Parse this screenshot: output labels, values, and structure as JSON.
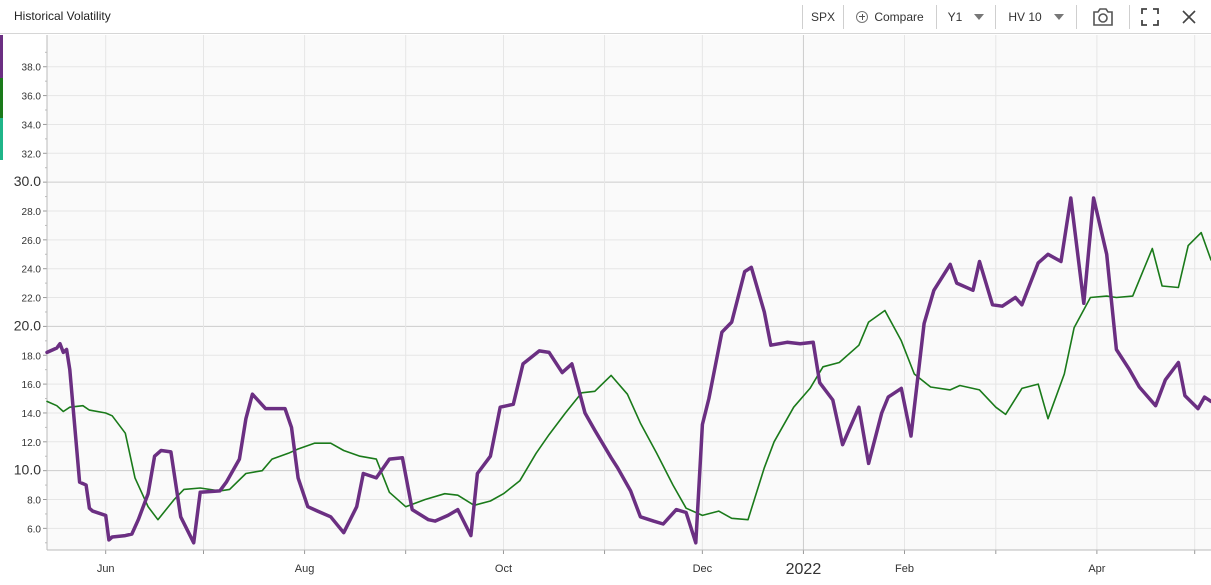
{
  "toolbar": {
    "title": "Historical Volatility",
    "symbol": "SPX",
    "compare_label": "Compare",
    "range_value": "Y1",
    "indicator_value": "HV 10",
    "icons": [
      "plus-circle-icon",
      "chevron-down-icon",
      "camera-icon",
      "fullscreen-icon",
      "close-icon"
    ]
  },
  "colors": {
    "series_primary": "#6b2f82",
    "series_secondary": "#1a7a1a",
    "grid": "#e6e6e6",
    "major_grid": "#cccccc",
    "strip": [
      "#6b2f82",
      "#1a7a1a",
      "#1fb589"
    ]
  },
  "chart_data": {
    "type": "line",
    "title": "",
    "xlabel": "",
    "ylabel": "",
    "x_range": [
      "2021-05-14",
      "2022-05-06"
    ],
    "ylim": [
      4.5,
      40.2
    ],
    "y_ticks": [
      {
        "v": 6,
        "label": "6.0"
      },
      {
        "v": 8,
        "label": "8.0"
      },
      {
        "v": 10,
        "label": "10.0"
      },
      {
        "v": 12,
        "label": "12.0"
      },
      {
        "v": 14,
        "label": "14.0"
      },
      {
        "v": 16,
        "label": "16.0"
      },
      {
        "v": 18,
        "label": "18.0"
      },
      {
        "v": 20,
        "label": "20.0"
      },
      {
        "v": 22,
        "label": "22.0"
      },
      {
        "v": 24,
        "label": "24.0"
      },
      {
        "v": 26,
        "label": "26.0"
      },
      {
        "v": 28,
        "label": "28.0"
      },
      {
        "v": 30,
        "label": "30.0"
      },
      {
        "v": 32,
        "label": "32.0"
      },
      {
        "v": 34,
        "label": "34.0"
      },
      {
        "v": 36,
        "label": "36.0"
      },
      {
        "v": 38,
        "label": "38.0"
      }
    ],
    "major_y": [
      10,
      20,
      30
    ],
    "x_ticks": [
      {
        "date": "2021-06-01",
        "label": "Jun"
      },
      {
        "date": "2021-08-01",
        "label": "Aug"
      },
      {
        "date": "2021-10-01",
        "label": "Oct"
      },
      {
        "date": "2021-12-01",
        "label": "Dec"
      },
      {
        "date": "2022-01-01",
        "label": "2022",
        "major": true
      },
      {
        "date": "2022-02-01",
        "label": "Feb"
      },
      {
        "date": "2022-04-01",
        "label": "Apr"
      }
    ],
    "minor_x": [
      "2021-07-01",
      "2021-09-01",
      "2021-11-01",
      "2022-03-01",
      "2022-05-01"
    ],
    "grid": true,
    "legend": "none",
    "series": [
      {
        "role": "primary",
        "x": [
          "2021-05-14",
          "2021-05-17",
          "2021-05-18",
          "2021-05-19",
          "2021-05-20",
          "2021-05-21",
          "2021-05-24",
          "2021-05-25",
          "2021-05-26",
          "2021-05-27",
          "2021-05-28",
          "2021-06-01",
          "2021-06-02",
          "2021-06-03",
          "2021-06-07",
          "2021-06-09",
          "2021-06-11",
          "2021-06-14",
          "2021-06-16",
          "2021-06-18",
          "2021-06-21",
          "2021-06-24",
          "2021-06-28",
          "2021-06-30",
          "2021-07-06",
          "2021-07-08",
          "2021-07-12",
          "2021-07-14",
          "2021-07-16",
          "2021-07-20",
          "2021-07-22",
          "2021-07-26",
          "2021-07-28",
          "2021-07-30",
          "2021-08-02",
          "2021-08-05",
          "2021-08-09",
          "2021-08-13",
          "2021-08-17",
          "2021-08-19",
          "2021-08-23",
          "2021-08-27",
          "2021-08-31",
          "2021-09-03",
          "2021-09-08",
          "2021-09-10",
          "2021-09-14",
          "2021-09-17",
          "2021-09-21",
          "2021-09-23",
          "2021-09-27",
          "2021-09-30",
          "2021-10-04",
          "2021-10-07",
          "2021-10-12",
          "2021-10-15",
          "2021-10-19",
          "2021-10-22",
          "2021-10-26",
          "2021-10-29",
          "2021-11-03",
          "2021-11-05",
          "2021-11-09",
          "2021-11-12",
          "2021-11-16",
          "2021-11-19",
          "2021-11-23",
          "2021-11-26",
          "2021-11-29",
          "2021-12-01",
          "2021-12-03",
          "2021-12-07",
          "2021-12-10",
          "2021-12-14",
          "2021-12-16",
          "2021-12-20",
          "2021-12-22",
          "2021-12-27",
          "2021-12-31",
          "2022-01-04",
          "2022-01-06",
          "2022-01-10",
          "2022-01-13",
          "2022-01-18",
          "2022-01-21",
          "2022-01-25",
          "2022-01-27",
          "2022-01-31",
          "2022-02-03",
          "2022-02-07",
          "2022-02-10",
          "2022-02-15",
          "2022-02-17",
          "2022-02-22",
          "2022-02-24",
          "2022-02-28",
          "2022-03-03",
          "2022-03-07",
          "2022-03-09",
          "2022-03-14",
          "2022-03-17",
          "2022-03-21",
          "2022-03-24",
          "2022-03-28",
          "2022-03-31",
          "2022-04-04",
          "2022-04-07",
          "2022-04-11",
          "2022-04-14",
          "2022-04-19",
          "2022-04-22",
          "2022-04-26",
          "2022-04-28",
          "2022-05-02",
          "2022-05-04",
          "2022-05-06"
        ],
        "y": [
          18.2,
          18.5,
          18.8,
          18.2,
          18.4,
          17.0,
          9.2,
          9.1,
          9.0,
          7.4,
          7.2,
          6.9,
          5.2,
          5.4,
          5.5,
          5.6,
          6.6,
          8.4,
          11.0,
          11.4,
          11.3,
          6.8,
          5.0,
          8.5,
          8.6,
          9.2,
          10.8,
          13.6,
          15.3,
          14.3,
          14.3,
          14.3,
          13.0,
          9.5,
          7.5,
          7.2,
          6.8,
          5.7,
          7.5,
          9.8,
          9.5,
          10.8,
          10.9,
          7.3,
          6.6,
          6.5,
          6.9,
          7.3,
          5.5,
          9.8,
          11.0,
          14.4,
          14.6,
          17.4,
          18.3,
          18.2,
          16.8,
          17.4,
          14.0,
          12.8,
          10.9,
          10.2,
          8.6,
          6.8,
          6.5,
          6.3,
          7.3,
          7.1,
          5.0,
          13.2,
          15.0,
          19.6,
          20.3,
          23.8,
          24.1,
          21.0,
          18.7,
          18.9,
          18.8,
          18.9,
          16.1,
          14.9,
          11.8,
          14.4,
          10.5,
          14.0,
          15.1,
          15.7,
          12.4,
          20.2,
          22.5,
          24.3,
          23.0,
          22.5,
          24.5,
          21.5,
          21.4,
          22.0,
          21.5,
          24.4,
          25.0,
          24.5,
          28.9,
          21.6,
          28.9,
          25.0,
          18.4,
          17.0,
          15.8,
          14.5,
          16.3,
          17.5,
          15.2,
          14.3,
          15.1,
          14.8
        ]
      },
      {
        "role": "secondary",
        "x": [
          "2021-05-14",
          "2021-05-17",
          "2021-05-19",
          "2021-05-21",
          "2021-05-25",
          "2021-05-27",
          "2021-06-01",
          "2021-06-03",
          "2021-06-07",
          "2021-06-10",
          "2021-06-14",
          "2021-06-17",
          "2021-06-22",
          "2021-06-25",
          "2021-06-30",
          "2021-07-06",
          "2021-07-09",
          "2021-07-14",
          "2021-07-19",
          "2021-07-22",
          "2021-07-27",
          "2021-07-30",
          "2021-08-04",
          "2021-08-09",
          "2021-08-13",
          "2021-08-18",
          "2021-08-23",
          "2021-08-27",
          "2021-09-01",
          "2021-09-07",
          "2021-09-13",
          "2021-09-17",
          "2021-09-22",
          "2021-09-27",
          "2021-10-01",
          "2021-10-06",
          "2021-10-11",
          "2021-10-15",
          "2021-10-20",
          "2021-10-25",
          "2021-10-29",
          "2021-11-03",
          "2021-11-08",
          "2021-11-12",
          "2021-11-17",
          "2021-11-22",
          "2021-11-26",
          "2021-12-01",
          "2021-12-06",
          "2021-12-10",
          "2021-12-15",
          "2021-12-20",
          "2021-12-23",
          "2021-12-29",
          "2022-01-03",
          "2022-01-07",
          "2022-01-12",
          "2022-01-18",
          "2022-01-21",
          "2022-01-26",
          "2022-01-31",
          "2022-02-04",
          "2022-02-09",
          "2022-02-15",
          "2022-02-18",
          "2022-02-24",
          "2022-03-01",
          "2022-03-04",
          "2022-03-09",
          "2022-03-14",
          "2022-03-17",
          "2022-03-22",
          "2022-03-25",
          "2022-03-30",
          "2022-04-04",
          "2022-04-07",
          "2022-04-12",
          "2022-04-18",
          "2022-04-21",
          "2022-04-26",
          "2022-04-29",
          "2022-05-03",
          "2022-05-06"
        ],
        "y": [
          14.8,
          14.5,
          14.1,
          14.4,
          14.5,
          14.2,
          14.0,
          13.8,
          12.6,
          9.5,
          7.5,
          6.6,
          8.0,
          8.7,
          8.8,
          8.6,
          8.7,
          9.8,
          10.0,
          10.8,
          11.2,
          11.5,
          11.9,
          11.9,
          11.4,
          11.0,
          10.8,
          8.5,
          7.5,
          8.0,
          8.4,
          8.3,
          7.6,
          7.9,
          8.4,
          9.3,
          11.2,
          12.5,
          14.0,
          15.4,
          15.5,
          16.6,
          15.3,
          13.3,
          11.2,
          9.0,
          7.4,
          6.9,
          7.2,
          6.7,
          6.6,
          10.2,
          12.0,
          14.4,
          15.7,
          17.2,
          17.5,
          18.7,
          20.3,
          21.1,
          19.0,
          16.7,
          15.8,
          15.6,
          15.9,
          15.6,
          14.4,
          13.9,
          15.7,
          16.0,
          13.6,
          16.7,
          19.9,
          22.0,
          22.1,
          22.0,
          22.1,
          25.4,
          22.8,
          22.7,
          25.6,
          26.5,
          24.6
        ]
      }
    ]
  }
}
